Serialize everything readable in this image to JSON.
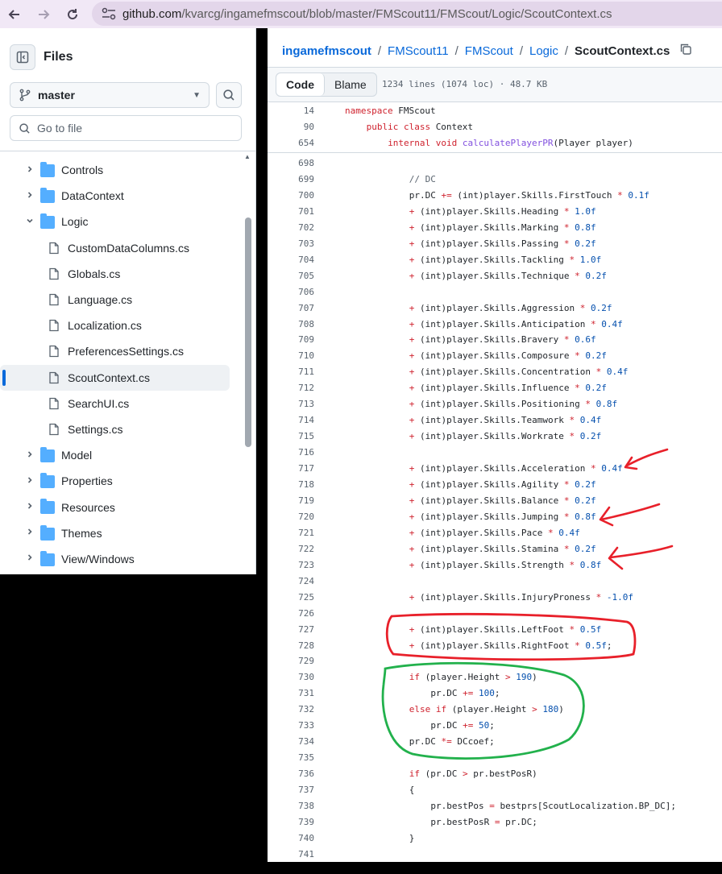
{
  "browser": {
    "url_host": "github.com",
    "url_path": "/kvarcg/ingamefmscout/blob/master/FMScout11/FMScout/Logic/ScoutContext.cs"
  },
  "sidebar": {
    "title": "Files",
    "branch": "master",
    "goto_placeholder": "Go to file",
    "tree": [
      {
        "label": "Controls",
        "type": "folder",
        "open": false
      },
      {
        "label": "DataContext",
        "type": "folder",
        "open": false
      },
      {
        "label": "Logic",
        "type": "folder",
        "open": true
      },
      {
        "label": "CustomDataColumns.cs",
        "type": "file"
      },
      {
        "label": "Globals.cs",
        "type": "file"
      },
      {
        "label": "Language.cs",
        "type": "file"
      },
      {
        "label": "Localization.cs",
        "type": "file"
      },
      {
        "label": "PreferencesSettings.cs",
        "type": "file"
      },
      {
        "label": "ScoutContext.cs",
        "type": "file",
        "active": true
      },
      {
        "label": "SearchUI.cs",
        "type": "file"
      },
      {
        "label": "Settings.cs",
        "type": "file"
      },
      {
        "label": "Model",
        "type": "folder",
        "open": false
      },
      {
        "label": "Properties",
        "type": "folder",
        "open": false
      },
      {
        "label": "Resources",
        "type": "folder",
        "open": false
      },
      {
        "label": "Themes",
        "type": "folder",
        "open": false
      },
      {
        "label": "View/Windows",
        "type": "folder",
        "open": false
      }
    ]
  },
  "breadcrumb": {
    "items": [
      "ingamefmscout",
      "FMScout11",
      "FMScout",
      "Logic"
    ],
    "current": "ScoutContext.cs"
  },
  "toolbar": {
    "code_tab": "Code",
    "blame_tab": "Blame",
    "file_info": "1234 lines (1074 loc) · 48.7 KB"
  },
  "sticky_lines": [
    {
      "n": "14",
      "indent": 0,
      "parts": [
        [
          "kw",
          "namespace "
        ],
        [
          "",
          "FMScout"
        ]
      ]
    },
    {
      "n": "90",
      "indent": 4,
      "parts": [
        [
          "kw",
          "public class "
        ],
        [
          "",
          "Context"
        ]
      ]
    },
    {
      "n": "654",
      "indent": 8,
      "parts": [
        [
          "kw",
          "internal void "
        ],
        [
          "fn",
          "calculatePlayerPR"
        ],
        [
          "",
          "(Player player)"
        ]
      ]
    }
  ],
  "code_lines": [
    {
      "n": "698",
      "indent": 0,
      "parts": []
    },
    {
      "n": "699",
      "indent": 12,
      "parts": [
        [
          "cm",
          "// DC"
        ]
      ]
    },
    {
      "n": "700",
      "indent": 12,
      "parts": [
        [
          "",
          "pr.DC "
        ],
        [
          "kw",
          "+="
        ],
        [
          "",
          " (int)player.Skills.FirstTouch "
        ],
        [
          "kw",
          "*"
        ],
        [
          "num",
          " 0.1f"
        ]
      ]
    },
    {
      "n": "701",
      "indent": 12,
      "parts": [
        [
          "kw",
          "+"
        ],
        [
          "",
          " (int)player.Skills.Heading "
        ],
        [
          "kw",
          "*"
        ],
        [
          "num",
          " 1.0f"
        ]
      ]
    },
    {
      "n": "702",
      "indent": 12,
      "parts": [
        [
          "kw",
          "+"
        ],
        [
          "",
          " (int)player.Skills.Marking "
        ],
        [
          "kw",
          "*"
        ],
        [
          "num",
          " 0.8f"
        ]
      ]
    },
    {
      "n": "703",
      "indent": 12,
      "parts": [
        [
          "kw",
          "+"
        ],
        [
          "",
          " (int)player.Skills.Passing "
        ],
        [
          "kw",
          "*"
        ],
        [
          "num",
          " 0.2f"
        ]
      ]
    },
    {
      "n": "704",
      "indent": 12,
      "parts": [
        [
          "kw",
          "+"
        ],
        [
          "",
          " (int)player.Skills.Tackling "
        ],
        [
          "kw",
          "*"
        ],
        [
          "num",
          " 1.0f"
        ]
      ]
    },
    {
      "n": "705",
      "indent": 12,
      "parts": [
        [
          "kw",
          "+"
        ],
        [
          "",
          " (int)player.Skills.Technique "
        ],
        [
          "kw",
          "*"
        ],
        [
          "num",
          " 0.2f"
        ]
      ]
    },
    {
      "n": "706",
      "indent": 0,
      "parts": []
    },
    {
      "n": "707",
      "indent": 12,
      "parts": [
        [
          "kw",
          "+"
        ],
        [
          "",
          " (int)player.Skills.Aggression "
        ],
        [
          "kw",
          "*"
        ],
        [
          "num",
          " 0.2f"
        ]
      ]
    },
    {
      "n": "708",
      "indent": 12,
      "parts": [
        [
          "kw",
          "+"
        ],
        [
          "",
          " (int)player.Skills.Anticipation "
        ],
        [
          "kw",
          "*"
        ],
        [
          "num",
          " 0.4f"
        ]
      ]
    },
    {
      "n": "709",
      "indent": 12,
      "parts": [
        [
          "kw",
          "+"
        ],
        [
          "",
          " (int)player.Skills.Bravery "
        ],
        [
          "kw",
          "*"
        ],
        [
          "num",
          " 0.6f"
        ]
      ]
    },
    {
      "n": "710",
      "indent": 12,
      "parts": [
        [
          "kw",
          "+"
        ],
        [
          "",
          " (int)player.Skills.Composure "
        ],
        [
          "kw",
          "*"
        ],
        [
          "num",
          " 0.2f"
        ]
      ]
    },
    {
      "n": "711",
      "indent": 12,
      "parts": [
        [
          "kw",
          "+"
        ],
        [
          "",
          " (int)player.Skills.Concentration "
        ],
        [
          "kw",
          "*"
        ],
        [
          "num",
          " 0.4f"
        ]
      ]
    },
    {
      "n": "712",
      "indent": 12,
      "parts": [
        [
          "kw",
          "+"
        ],
        [
          "",
          " (int)player.Skills.Influence "
        ],
        [
          "kw",
          "*"
        ],
        [
          "num",
          " 0.2f"
        ]
      ]
    },
    {
      "n": "713",
      "indent": 12,
      "parts": [
        [
          "kw",
          "+"
        ],
        [
          "",
          " (int)player.Skills.Positioning "
        ],
        [
          "kw",
          "*"
        ],
        [
          "num",
          " 0.8f"
        ]
      ]
    },
    {
      "n": "714",
      "indent": 12,
      "parts": [
        [
          "kw",
          "+"
        ],
        [
          "",
          " (int)player.Skills.Teamwork "
        ],
        [
          "kw",
          "*"
        ],
        [
          "num",
          " 0.4f"
        ]
      ]
    },
    {
      "n": "715",
      "indent": 12,
      "parts": [
        [
          "kw",
          "+"
        ],
        [
          "",
          " (int)player.Skills.Workrate "
        ],
        [
          "kw",
          "*"
        ],
        [
          "num",
          " 0.2f"
        ]
      ]
    },
    {
      "n": "716",
      "indent": 0,
      "parts": []
    },
    {
      "n": "717",
      "indent": 12,
      "parts": [
        [
          "kw",
          "+"
        ],
        [
          "",
          " (int)player.Skills.Acceleration "
        ],
        [
          "kw",
          "*"
        ],
        [
          "num",
          " 0.4f"
        ]
      ]
    },
    {
      "n": "718",
      "indent": 12,
      "parts": [
        [
          "kw",
          "+"
        ],
        [
          "",
          " (int)player.Skills.Agility "
        ],
        [
          "kw",
          "*"
        ],
        [
          "num",
          " 0.2f"
        ]
      ]
    },
    {
      "n": "719",
      "indent": 12,
      "parts": [
        [
          "kw",
          "+"
        ],
        [
          "",
          " (int)player.Skills.Balance "
        ],
        [
          "kw",
          "*"
        ],
        [
          "num",
          " 0.2f"
        ]
      ]
    },
    {
      "n": "720",
      "indent": 12,
      "parts": [
        [
          "kw",
          "+"
        ],
        [
          "",
          " (int)player.Skills.Jumping "
        ],
        [
          "kw",
          "*"
        ],
        [
          "num",
          " 0.8f"
        ]
      ]
    },
    {
      "n": "721",
      "indent": 12,
      "parts": [
        [
          "kw",
          "+"
        ],
        [
          "",
          " (int)player.Skills.Pace "
        ],
        [
          "kw",
          "*"
        ],
        [
          "num",
          " 0.4f"
        ]
      ]
    },
    {
      "n": "722",
      "indent": 12,
      "parts": [
        [
          "kw",
          "+"
        ],
        [
          "",
          " (int)player.Skills.Stamina "
        ],
        [
          "kw",
          "*"
        ],
        [
          "num",
          " 0.2f"
        ]
      ]
    },
    {
      "n": "723",
      "indent": 12,
      "parts": [
        [
          "kw",
          "+"
        ],
        [
          "",
          " (int)player.Skills.Strength "
        ],
        [
          "kw",
          "*"
        ],
        [
          "num",
          " 0.8f"
        ]
      ]
    },
    {
      "n": "724",
      "indent": 0,
      "parts": []
    },
    {
      "n": "725",
      "indent": 12,
      "parts": [
        [
          "kw",
          "+"
        ],
        [
          "",
          " (int)player.Skills.InjuryProness "
        ],
        [
          "kw",
          "*"
        ],
        [
          "num",
          " -1.0f"
        ]
      ]
    },
    {
      "n": "726",
      "indent": 0,
      "parts": []
    },
    {
      "n": "727",
      "indent": 12,
      "parts": [
        [
          "kw",
          "+"
        ],
        [
          "",
          " (int)player.Skills.LeftFoot "
        ],
        [
          "kw",
          "*"
        ],
        [
          "num",
          " 0.5f"
        ]
      ]
    },
    {
      "n": "728",
      "indent": 12,
      "parts": [
        [
          "kw",
          "+"
        ],
        [
          "",
          " (int)player.Skills.RightFoot "
        ],
        [
          "kw",
          "*"
        ],
        [
          "num",
          " 0.5f"
        ],
        [
          "",
          ";"
        ]
      ]
    },
    {
      "n": "729",
      "indent": 0,
      "parts": []
    },
    {
      "n": "730",
      "indent": 12,
      "parts": [
        [
          "kw",
          "if"
        ],
        [
          "",
          " (player.Height "
        ],
        [
          "kw",
          ">"
        ],
        [
          "num",
          " 190"
        ],
        [
          "",
          ")"
        ]
      ]
    },
    {
      "n": "731",
      "indent": 16,
      "parts": [
        [
          "",
          "pr.DC "
        ],
        [
          "kw",
          "+="
        ],
        [
          "num",
          " 100"
        ],
        [
          "",
          ";"
        ]
      ]
    },
    {
      "n": "732",
      "indent": 12,
      "parts": [
        [
          "kw",
          "else if"
        ],
        [
          "",
          " (player.Height "
        ],
        [
          "kw",
          ">"
        ],
        [
          "num",
          " 180"
        ],
        [
          "",
          ")"
        ]
      ]
    },
    {
      "n": "733",
      "indent": 16,
      "parts": [
        [
          "",
          "pr.DC "
        ],
        [
          "kw",
          "+="
        ],
        [
          "num",
          " 50"
        ],
        [
          "",
          ";"
        ]
      ]
    },
    {
      "n": "734",
      "indent": 12,
      "parts": [
        [
          "",
          "pr.DC "
        ],
        [
          "kw",
          "*="
        ],
        [
          "",
          " DCcoef;"
        ]
      ]
    },
    {
      "n": "735",
      "indent": 0,
      "parts": []
    },
    {
      "n": "736",
      "indent": 12,
      "parts": [
        [
          "kw",
          "if"
        ],
        [
          "",
          " (pr.DC "
        ],
        [
          "kw",
          ">"
        ],
        [
          "",
          " pr.bestPosR)"
        ]
      ]
    },
    {
      "n": "737",
      "indent": 12,
      "parts": [
        [
          "",
          "{"
        ]
      ]
    },
    {
      "n": "738",
      "indent": 16,
      "parts": [
        [
          "",
          "pr.bestPos "
        ],
        [
          "kw",
          "="
        ],
        [
          "",
          " bestprs[ScoutLocalization.BP_DC];"
        ]
      ]
    },
    {
      "n": "739",
      "indent": 16,
      "parts": [
        [
          "",
          "pr.bestPosR "
        ],
        [
          "kw",
          "="
        ],
        [
          "",
          " pr.DC;"
        ]
      ]
    },
    {
      "n": "740",
      "indent": 12,
      "parts": [
        [
          "",
          "}"
        ]
      ]
    },
    {
      "n": "741",
      "indent": 0,
      "parts": []
    }
  ],
  "colors": {
    "keyword": "#cf222e",
    "function": "#8250df",
    "number": "#0550ae",
    "link": "#0969da",
    "annotation_red": "#e8202a",
    "annotation_green": "#22b14c"
  }
}
